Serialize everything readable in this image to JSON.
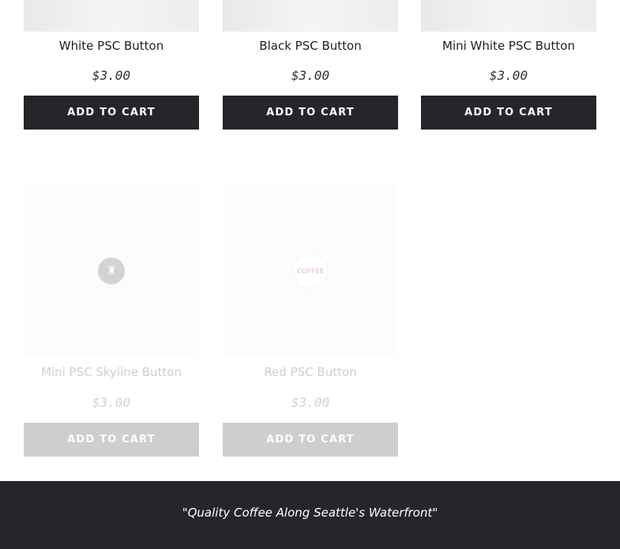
{
  "products": [
    {
      "name": "White PSC Button",
      "price": "$3.00",
      "button_label": "ADD TO CART"
    },
    {
      "name": "Black PSC Button",
      "price": "$3.00",
      "button_label": "ADD TO CART"
    },
    {
      "name": "Mini White PSC Button",
      "price": "$3.00",
      "button_label": "ADD TO CART"
    },
    {
      "name": "Mini PSC Skyline Button",
      "price": "$3.00",
      "button_label": "ADD TO CART",
      "image_badge_icon": "skyline-icon"
    },
    {
      "name": "Red PSC Button",
      "price": "$3.00",
      "button_label": "ADD TO CART",
      "image_badge_text": "COFFEE"
    }
  ],
  "footer": {
    "tagline": "\"Quality Coffee Along Seattle's Waterfront\""
  },
  "colors": {
    "button_bg": "#26252a",
    "footer_bg": "#26252a",
    "badge_red": "#c0282f"
  }
}
